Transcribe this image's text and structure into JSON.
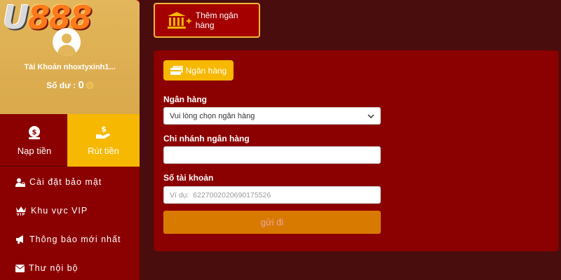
{
  "sidebar": {
    "logo": "U888",
    "account_name": "Tài Khoản nhoxtyxinh1...",
    "balance_label": "Số dư :",
    "balance_value": "0",
    "deposit_label": "Nạp tiền",
    "withdraw_label": "Rút tiền",
    "menu": [
      {
        "label": "Cài đặt bảo mật",
        "icon": "user-lock-icon"
      },
      {
        "label": "Khu vực VIP",
        "icon": "crown-vip-icon"
      },
      {
        "label": "Thông báo mới nhất",
        "icon": "megaphone-icon"
      },
      {
        "label": "Thư nội bộ",
        "icon": "envelope-icon"
      }
    ]
  },
  "main": {
    "add_bank_label": "Thêm ngân hàng",
    "tab_label": "Ngân hàng",
    "bank_label": "Ngân hàng",
    "bank_select_value": "Vui lòng chọn ngân hàng",
    "branch_label": "Chi nhánh ngân hàng",
    "branch_value": "",
    "account_label": "Số tài khoản",
    "account_placeholder": "Ví dụ:  6227002020690175526",
    "submit_label": "gửi đi"
  },
  "colors": {
    "background": "#4a0d0d",
    "panel": "#8b0000",
    "accent": "#f6b800",
    "profile": "#e3b65b",
    "submit": "#d97a00"
  }
}
